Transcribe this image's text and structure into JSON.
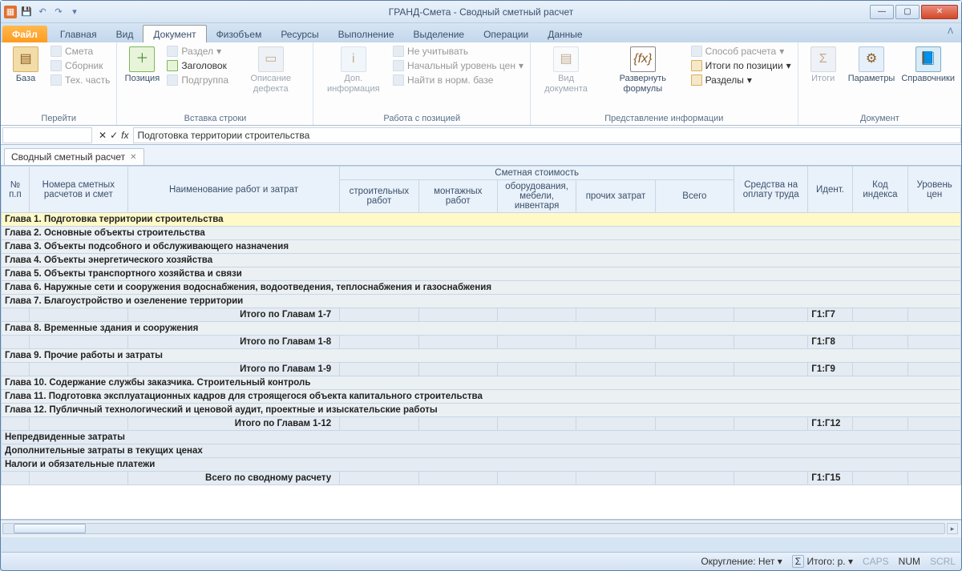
{
  "window": {
    "title": "ГРАНД-Смета - Сводный сметный расчет"
  },
  "tabs": {
    "file": "Файл",
    "items": [
      "Главная",
      "Вид",
      "Документ",
      "Физобъем",
      "Ресурсы",
      "Выполнение",
      "Выделение",
      "Операции",
      "Данные"
    ],
    "active": "Документ"
  },
  "ribbon": {
    "groups": {
      "go": {
        "label": "Перейти",
        "base": "База",
        "smeta": "Смета",
        "sbornik": "Сборник",
        "tehchast": "Тех. часть"
      },
      "insert": {
        "label": "Вставка строки",
        "position": "Позиция",
        "section": "Раздел",
        "header": "Заголовок",
        "subgroup": "Подгруппа",
        "defect": "Описание дефекта"
      },
      "work": {
        "label": "Работа с позицией",
        "dopinfo": "Доп. информация",
        "neuchit": "Не учитывать",
        "startlevel": "Начальный уровень цен",
        "findnorm": "Найти в норм. базе"
      },
      "view": {
        "label": "Представление информации",
        "docview": "Вид документа",
        "formulas": "Развернуть формулы",
        "calcmethod": "Способ расчета",
        "itogipos": "Итоги по позиции",
        "sections": "Разделы"
      },
      "doc": {
        "label": "Документ",
        "itogi": "Итоги",
        "params": "Параметры",
        "refs": "Справочники"
      }
    }
  },
  "fx": {
    "value": "Подготовка территории строительства"
  },
  "doctab": {
    "label": "Сводный сметный расчет"
  },
  "columns": {
    "nn": "№ п.п",
    "nom": "Номера сметных расчетов и смет",
    "name": "Наименование работ и затрат",
    "cost_group": "Сметная стоимость",
    "c_build": "строительных работ",
    "c_mont": "монтажных работ",
    "c_equip": "оборудования, мебели, инвентаря",
    "c_other": "прочих затрат",
    "c_total": "Всего",
    "ot": "Средства на оплату труда",
    "ident": "Идент.",
    "kodidx": "Код индекса",
    "urc": "Уровень цен"
  },
  "rows": [
    {
      "type": "chapter",
      "sel": true,
      "name": "Глава 1. Подготовка территории строительства"
    },
    {
      "type": "chapter",
      "name": "Глава 2. Основные объекты строительства"
    },
    {
      "type": "chapter",
      "name": "Глава 3. Объекты подсобного и обслуживающего назначения"
    },
    {
      "type": "chapter",
      "name": "Глава 4. Объекты энергетического хозяйства"
    },
    {
      "type": "chapter",
      "name": "Глава 5. Объекты транспортного хозяйства и связи"
    },
    {
      "type": "chapter",
      "name": "Глава 6. Наружные сети и сооружения водоснабжения, водоотведения, теплоснабжения и газоснабжения"
    },
    {
      "type": "chapter",
      "name": "Глава 7. Благоустройство и озеленение территории"
    },
    {
      "type": "subtotal",
      "name": "Итого по Главам 1-7",
      "ident": "Г1:Г7"
    },
    {
      "type": "chapter",
      "name": "Глава 8. Временные здания и сооружения"
    },
    {
      "type": "subtotal",
      "name": "Итого по Главам 1-8",
      "ident": "Г1:Г8"
    },
    {
      "type": "chapter",
      "name": "Глава 9. Прочие работы и затраты"
    },
    {
      "type": "subtotal",
      "name": "Итого по Главам 1-9",
      "ident": "Г1:Г9"
    },
    {
      "type": "chapter",
      "name": "Глава 10. Содержание службы заказчика. Строительный контроль"
    },
    {
      "type": "chapter",
      "name": "Глава 11. Подготовка эксплуатационных кадров для строящегося объекта капитального строительства"
    },
    {
      "type": "chapter",
      "name": "Глава 12. Публичный технологический и ценовой аудит, проектные и изыскательские работы"
    },
    {
      "type": "subtotal",
      "name": "Итого по Главам 1-12",
      "ident": "Г1:Г12"
    },
    {
      "type": "summary",
      "name": "Непредвиденные затраты"
    },
    {
      "type": "summary",
      "name": "Дополнительные затраты в текущих ценах"
    },
    {
      "type": "summary",
      "name": "Налоги и обязательные платежи"
    },
    {
      "type": "total",
      "name": "Всего по сводному расчету",
      "ident": "Г1:Г15"
    }
  ],
  "status": {
    "round": "Округление: Нет",
    "sigma": "Σ",
    "total": "Итого: р.",
    "caps": "CAPS",
    "num": "NUM",
    "scrl": "SCRL"
  }
}
